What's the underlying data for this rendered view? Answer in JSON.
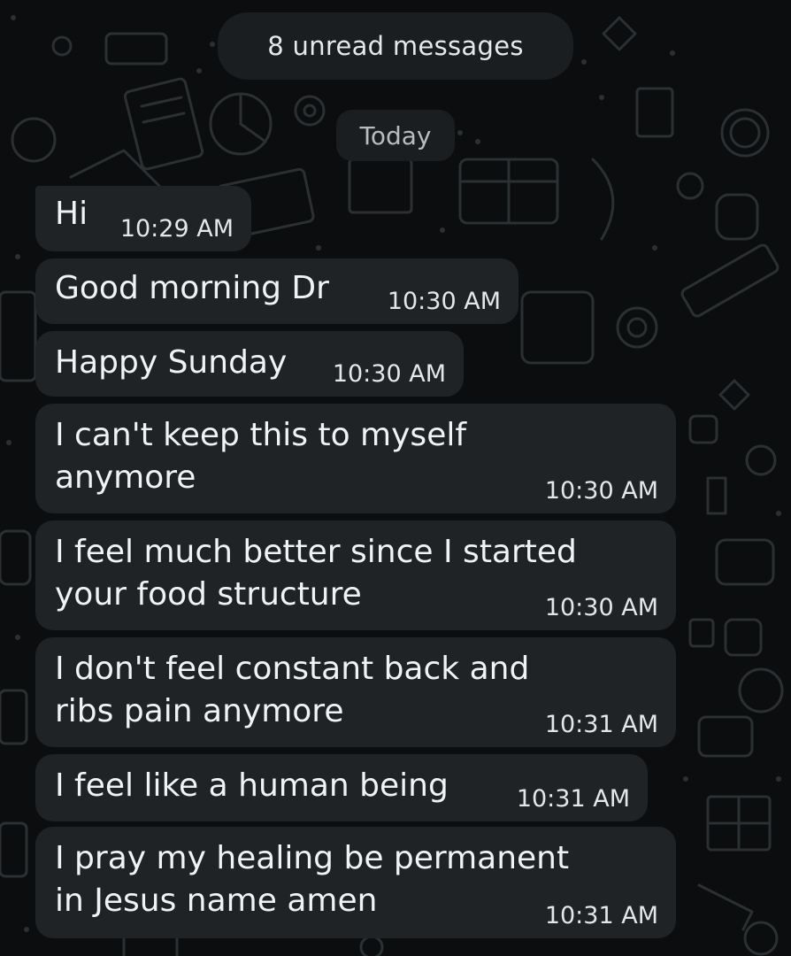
{
  "banner": {
    "unread_label": "8 unread messages",
    "date_separator": "Today"
  },
  "messages": [
    {
      "text": "Hi",
      "time": "10:29 AM"
    },
    {
      "text": "Good morning Dr",
      "time": "10:30 AM"
    },
    {
      "text": "Happy Sunday",
      "time": "10:30 AM"
    },
    {
      "text": "I can't keep this to myself\nanymore",
      "time": "10:30 AM"
    },
    {
      "text": "I feel much better since I started\nyour food structure",
      "time": "10:30 AM"
    },
    {
      "text": "I don't feel constant back and\nribs pain anymore",
      "time": "10:31 AM"
    },
    {
      "text": "I feel like a human being",
      "time": "10:31 AM"
    },
    {
      "text": "I pray my healing be permanent\nin Jesus name amen",
      "time": "10:31 AM"
    }
  ],
  "colors": {
    "background": "#0b0d0e",
    "bubble": "#1f2326",
    "pill": "#1b1e20",
    "doodle": "#2a2f32"
  }
}
